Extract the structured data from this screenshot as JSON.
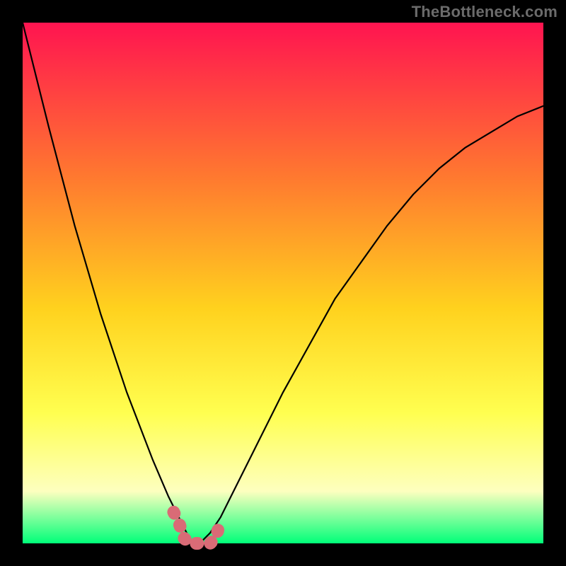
{
  "watermark": "TheBottleneck.com",
  "colors": {
    "background": "#000000",
    "curve": "#000000",
    "marker": "#d96b76",
    "grad_top": "#ff1450",
    "grad_mid1": "#ff7a2f",
    "grad_mid2": "#ffd21e",
    "grad_mid3": "#ffff50",
    "grad_mid4": "#fdffbf",
    "grad_bottom": "#00ff79"
  },
  "plot": {
    "inner_x": 32,
    "inner_y": 32,
    "inner_w": 736,
    "inner_h": 736
  },
  "chart_data": {
    "type": "line",
    "title": "",
    "xlabel": "",
    "ylabel": "",
    "xlim": [
      0,
      100
    ],
    "ylim": [
      0,
      100
    ],
    "grid": false,
    "series": [
      {
        "name": "bottleneck-curve",
        "x": [
          0,
          5,
          10,
          15,
          20,
          25,
          28,
          30,
          31,
          32,
          33,
          34,
          35,
          36,
          38,
          40,
          45,
          50,
          55,
          60,
          65,
          70,
          75,
          80,
          85,
          90,
          95,
          100
        ],
        "values": [
          100,
          80,
          61,
          44,
          29,
          16,
          9,
          5,
          3,
          1,
          0,
          0,
          1,
          2,
          5,
          9,
          19,
          29,
          38,
          47,
          54,
          61,
          67,
          72,
          76,
          79,
          82,
          84
        ]
      }
    ],
    "annotations": [
      {
        "name": "valley-marker",
        "shape": "polyline",
        "x": [
          29,
          30,
          30.5,
          31,
          32,
          33,
          34,
          35,
          36,
          37,
          38
        ],
        "values": [
          6,
          4,
          2.5,
          1,
          0,
          0,
          0,
          0,
          0,
          1,
          4
        ]
      }
    ]
  }
}
